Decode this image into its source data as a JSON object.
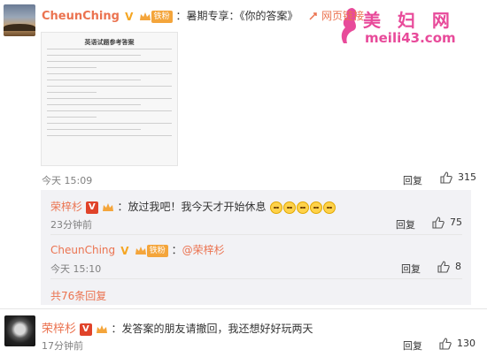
{
  "watermark": {
    "title": "美 妇 网",
    "url": "meili43.com"
  },
  "main_comment": {
    "author": "CheunChing",
    "verified": "V",
    "fan_badge": "铁粉",
    "separator": "：",
    "text": "暑期专享：《你的答案》",
    "link_label": "网页链接",
    "image_title": "英语试题参考答案",
    "time": "今天 15:09",
    "reply_label": "回复",
    "likes": "315"
  },
  "replies": [
    {
      "author": "荣梓杉",
      "verified": "V",
      "separator": "：",
      "text": "放过我吧！我今天才开始休息",
      "time": "23分钟前",
      "reply_label": "回复",
      "likes": "75"
    },
    {
      "author": "CheunChing",
      "verified": "V",
      "fan_badge": "铁粉",
      "separator": "：",
      "mention": "@荣梓杉",
      "time": "今天 15:10",
      "reply_label": "回复",
      "likes": "8"
    }
  ],
  "more_replies": "共76条回复",
  "second_comment": {
    "author": "荣梓杉",
    "verified": "V",
    "separator": "：",
    "text": "发答案的朋友请撤回，我还想好好玩两天",
    "time": "17分钟前",
    "reply_label": "回复",
    "likes": "130"
  },
  "icons": {
    "verified": "verified-v-icon",
    "crown": "crown-badge-icon",
    "link": "link-icon",
    "like": "thumb-up-icon",
    "emoji": "crying-emoji-icon"
  }
}
